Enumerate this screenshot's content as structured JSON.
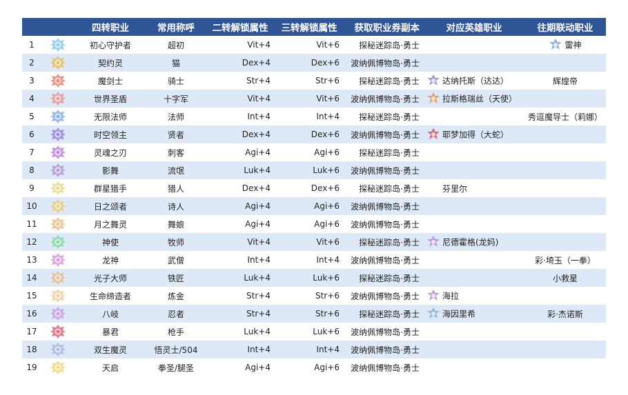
{
  "headers": {
    "num": "",
    "icon": "",
    "name": "四转职业",
    "common": "常用称呼",
    "attr2": "二转解锁属性",
    "attr3": "三转解锁属性",
    "dungeon": "获取职业券副本",
    "hero": "对应英雄职业",
    "collab": "往期联动职业"
  },
  "rows": [
    {
      "num": "1",
      "name": "初心守护者",
      "common": "超初",
      "attr2": "Vit+4",
      "attr3": "Vit+6",
      "dungeon": "探秘迷踪岛·勇士",
      "hero": "",
      "collab": "雷神",
      "collab_icon": "collab-emblem",
      "emblem_color": "#8ecbe8",
      "hero_color": ""
    },
    {
      "num": "2",
      "name": "契约灵",
      "common": "猫",
      "attr2": "Dex+4",
      "attr3": "Dex+6",
      "dungeon": "波纳佩博物岛·勇士",
      "hero": "",
      "collab": "",
      "emblem_color": "#e8c06a",
      "hero_color": ""
    },
    {
      "num": "3",
      "name": "魔剑士",
      "common": "骑士",
      "attr2": "Str+4",
      "attr3": "Str+6",
      "dungeon": "探秘迷踪岛·勇士",
      "hero": "达纳托斯（达达）",
      "collab": "辉煌帝",
      "emblem_color": "#e88a7a",
      "hero_color": "#a99ad8"
    },
    {
      "num": "4",
      "name": "世界圣盾",
      "common": "十字军",
      "attr2": "Vit+4",
      "attr3": "Vit+6",
      "dungeon": "波纳佩博物岛·勇士",
      "hero": "拉斯格瑞丝（天使）",
      "collab": "",
      "emblem_color": "#e89a9a",
      "hero_color": "#e8a070"
    },
    {
      "num": "5",
      "name": "无限法师",
      "common": "法师",
      "attr2": "Int+4",
      "attr3": "Int+4",
      "dungeon": "探秘迷踪岛·勇士",
      "hero": "",
      "collab": "秀逗魔导士（莉娜）",
      "emblem_color": "#8ab0e8",
      "hero_color": ""
    },
    {
      "num": "6",
      "name": "时空领主",
      "common": "贤者",
      "attr2": "Dex+4",
      "attr3": "Dex+6",
      "dungeon": "波纳佩博物岛·勇士",
      "hero": "耶梦加得（大蛇）",
      "collab": "",
      "emblem_color": "#9a8ae0",
      "hero_color": "#d86a7a"
    },
    {
      "num": "7",
      "name": "灵魂之刃",
      "common": "刺客",
      "attr2": "Agi+4",
      "attr3": "Agi+6",
      "dungeon": "探秘迷踪岛·勇士",
      "hero": "",
      "collab": "",
      "emblem_color": "#c08ae0",
      "hero_color": ""
    },
    {
      "num": "8",
      "name": "影舞",
      "common": "流氓",
      "attr2": "Luk+4",
      "attr3": "Luk+6",
      "dungeon": "波纳佩博物岛·勇士",
      "hero": "",
      "collab": "",
      "emblem_color": "#b89ad8",
      "hero_color": ""
    },
    {
      "num": "9",
      "name": "群星猎手",
      "common": "猎人",
      "attr2": "Dex+4",
      "attr3": "Dex+6",
      "dungeon": "探秘迷踪岛·勇士",
      "hero": "芬里尔",
      "collab": "",
      "emblem_color": "#e8dc90",
      "hero_color": ""
    },
    {
      "num": "10",
      "name": "日之颂者",
      "common": "诗人",
      "attr2": "Agi+4",
      "attr3": "Agi+6",
      "dungeon": "波纳佩博物岛·勇士",
      "hero": "",
      "collab": "",
      "emblem_color": "#e8cc80",
      "hero_color": ""
    },
    {
      "num": "11",
      "name": "月之舞灵",
      "common": "舞娘",
      "attr2": "Agi+4",
      "attr3": "Agi+6",
      "dungeon": "波纳佩博物岛·勇士",
      "hero": "",
      "collab": "",
      "emblem_color": "#e8c48a",
      "hero_color": ""
    },
    {
      "num": "12",
      "name": "神使",
      "common": "牧师",
      "attr2": "Vit+4",
      "attr3": "Vit+6",
      "dungeon": "探秘迷踪岛·勇士",
      "hero": "尼德霍格(龙妈)",
      "collab": "",
      "emblem_color": "#8ad8a8",
      "hero_color": "#b8a0e0"
    },
    {
      "num": "13",
      "name": "龙神",
      "common": "武僧",
      "attr2": "Int+4",
      "attr3": "Int+4",
      "dungeon": "波纳佩博物岛·勇士",
      "hero": "",
      "collab": "彩·埼玉（一拳）",
      "emblem_color": "#d8a0d8",
      "hero_color": ""
    },
    {
      "num": "14",
      "name": "光子大师",
      "common": "铁匠",
      "attr2": "Luk+4",
      "attr3": "Luk+6",
      "dungeon": "探秘迷踪岛·勇士",
      "hero": "",
      "collab": "小救星",
      "emblem_color": "#e8c090",
      "hero_color": ""
    },
    {
      "num": "15",
      "name": "生命缔造者",
      "common": "炼金",
      "attr2": "Str+4",
      "attr3": "Str+6",
      "dungeon": "波纳佩博物岛·勇士",
      "hero": "海拉",
      "collab": "",
      "emblem_color": "#f0d0a8",
      "hero_color": "#c0a0e0"
    },
    {
      "num": "16",
      "name": "八岐",
      "common": "忍者",
      "attr2": "Str+4",
      "attr3": "Str+6",
      "dungeon": "探秘迷踪岛·勇士",
      "hero": "海因里希",
      "collab": "彩·杰诺斯",
      "emblem_color": "#c8a0e8",
      "hero_color": "#90b8e0"
    },
    {
      "num": "17",
      "name": "暴君",
      "common": "枪手",
      "attr2": "Luk+4",
      "attr3": "Luk+6",
      "dungeon": "波纳佩博物岛·勇士",
      "hero": "",
      "collab": "",
      "emblem_color": "#e06a7a",
      "hero_color": ""
    },
    {
      "num": "18",
      "name": "双生魔灵",
      "common": "悟灵士/504",
      "attr2": "Int+4",
      "attr3": "Int+4",
      "dungeon": "波纳佩博物岛·勇士",
      "hero": "",
      "collab": "",
      "emblem_color": "#b0b8e0",
      "hero_color": ""
    },
    {
      "num": "19",
      "name": "天启",
      "common": "拳圣/腿圣",
      "attr2": "Agi+4",
      "attr3": "Agi+6",
      "dungeon": "波纳佩博物岛·勇士",
      "hero": "",
      "collab": "",
      "emblem_color": "#f0dc80",
      "hero_color": ""
    }
  ],
  "colors": {
    "header_bg": "#2f5597",
    "header_text": "#ffffff",
    "alt_row_bg": "#dde9f7",
    "collab_icon": "#8ab8e0"
  }
}
